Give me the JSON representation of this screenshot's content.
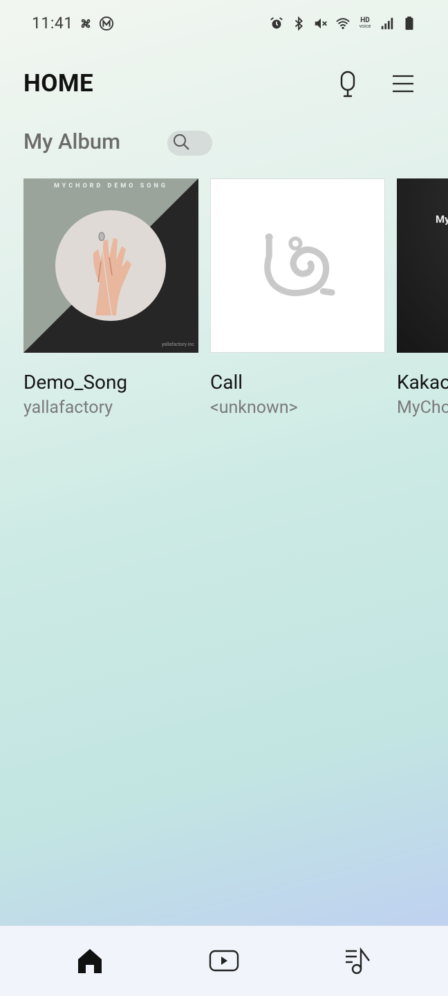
{
  "status_bar": {
    "time": "11:41",
    "left_icons": [
      "fan-icon",
      "m-badge-icon"
    ],
    "right_icons": [
      "alarm-icon",
      "bluetooth-icon",
      "mute-icon",
      "wifi-icon",
      "hd-voice-icon",
      "signal-icon",
      "battery-icon"
    ],
    "hd_label": "HD",
    "voice_label": "voice"
  },
  "header": {
    "title": "HOME",
    "mic_icon": "microphone-icon",
    "menu_icon": "hamburger-menu-icon"
  },
  "section": {
    "title": "My Album",
    "search_icon": "search-icon"
  },
  "albums": [
    {
      "title": "Demo_Song",
      "artist": "yallafactory",
      "art_top_text": "MYCHORD DEMO SONG",
      "art_credit": "yallafactory inc"
    },
    {
      "title": "Call",
      "artist": "<unknown>",
      "art_icon": "snail-placeholder-icon"
    },
    {
      "title": "Kakao",
      "artist": "MyChord",
      "art_text": "My"
    }
  ],
  "bottom_nav": {
    "items": [
      {
        "name": "home",
        "icon": "home-icon",
        "active": true
      },
      {
        "name": "video",
        "icon": "video-play-icon",
        "active": false
      },
      {
        "name": "playlist",
        "icon": "music-list-icon",
        "active": false
      }
    ]
  },
  "colors": {
    "title": "#111111",
    "section_title": "#6b6b6b",
    "artist": "#7a7a7a",
    "nav_bg": "#f1f4fa"
  }
}
